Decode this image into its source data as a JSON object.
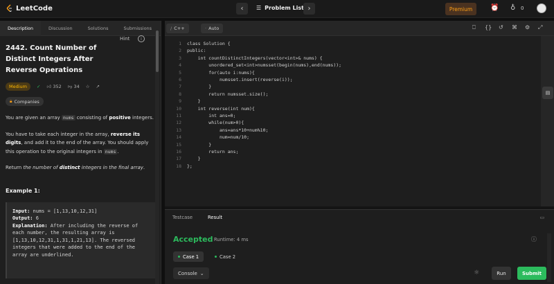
{
  "topbar": {
    "logo_text": "LeetCode",
    "problem_list": "Problem List",
    "premium": "Premium",
    "streak_count": "0",
    "icons": [
      "chevron-left-icon",
      "chevron-right-icon",
      "list-icon",
      "alarm-icon",
      "fire-icon",
      "avatar"
    ]
  },
  "left_tabs": [
    "Description",
    "Discussion",
    "Solutions",
    "Submissions"
  ],
  "problem": {
    "title": "2442. Count Number of Distinct Integers After Reverse Operations",
    "hint": "Hint",
    "difficulty": "Medium",
    "likes": "352",
    "dislikes": "34",
    "companies": "Companies",
    "p1_a": "You are given an array ",
    "p1_code": "nums",
    "p1_b": " consisting of ",
    "p1_bold": "positive",
    "p1_c": " integers.",
    "p2_a": "You have to take each integer in the array, ",
    "p2_bold": "reverse its digits",
    "p2_b": ", and add it to the end of the array. You should apply this operation to the original integers in ",
    "p2_code": "nums",
    "p2_c": ".",
    "p3_a": "Return ",
    "p3_ital": "the number of ",
    "p3_bold": "distinct",
    "p3_ital2": " integers in the final array",
    "p3_c": ".",
    "example_label": "Example 1:",
    "ex_input_label": "Input:",
    "ex_input": " nums = [1,13,10,12,31]",
    "ex_output_label": "Output:",
    "ex_output": " 6",
    "ex_expl_label": "Explanation:",
    "ex_expl": " After including the reverse of each number, the resulting array is [1,13,10,12,31,1,31,1,21,13]. The reversed integers that were added to the end of the array are underlined."
  },
  "editor": {
    "language": "C++",
    "mode": "Auto",
    "code_lines": [
      "class Solution {",
      "public:",
      "    int countDistinctIntegers(vector<int>& nums) {",
      "        unordered_set<int>numsset(begin(nums),end(nums));",
      "        for(auto i:nums){",
      "            numsset.insert(reverse(i));",
      "        }",
      "        return numsset.size();",
      "    }",
      "    int reverse(int num){",
      "        int ans=0;",
      "        while(num>0){",
      "            ans=ans*10+num%10;",
      "            num=num/10;",
      "        }",
      "        return ans;",
      "    }",
      "};"
    ]
  },
  "console": {
    "tabs": [
      "Testcase",
      "Result"
    ],
    "status": "Accepted",
    "runtime": "Runtime: 4 ms",
    "cases": [
      "Case 1",
      "Case 2"
    ],
    "console_label": "Console",
    "run_label": "Run",
    "submit_label": "Submit"
  }
}
